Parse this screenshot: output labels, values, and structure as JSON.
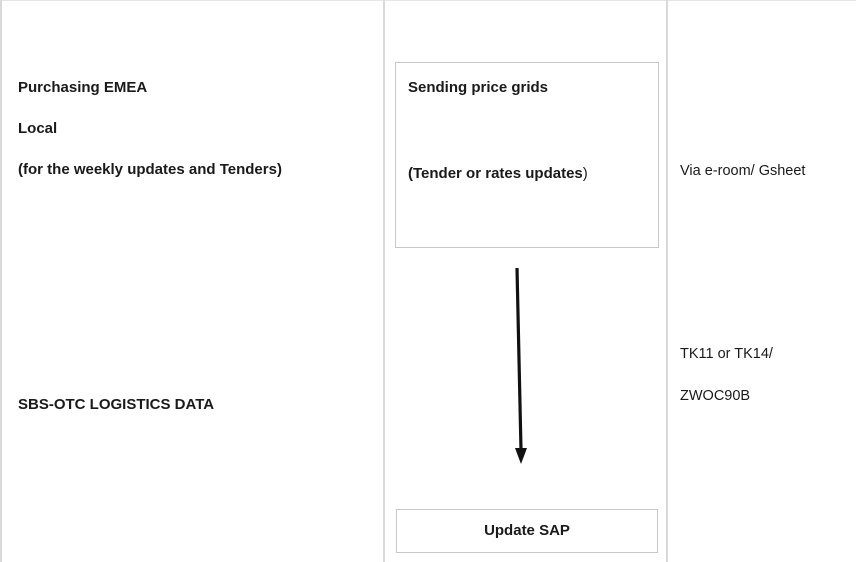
{
  "column_left": {
    "purchasing": "Purchasing EMEA",
    "local": "Local",
    "weekly_note": "(for the weekly updates and Tenders)",
    "sbs_otc": "SBS-OTC LOGISTICS DATA"
  },
  "column_middle": {
    "grids_title": "Sending price grids",
    "tender_text": "(Tender or rates updates",
    "tender_close": ")",
    "update_sap": "Update SAP",
    "arrow_icon": "down-arrow-icon"
  },
  "column_right": {
    "via": "Via e-room/ Gsheet",
    "tk": "TK11 or  TK14/",
    "zwoc": "ZWOC90B"
  },
  "colors": {
    "grid_line": "#d9d9d9",
    "box_border": "#c8c8c8",
    "text": "#1a1a1a"
  }
}
